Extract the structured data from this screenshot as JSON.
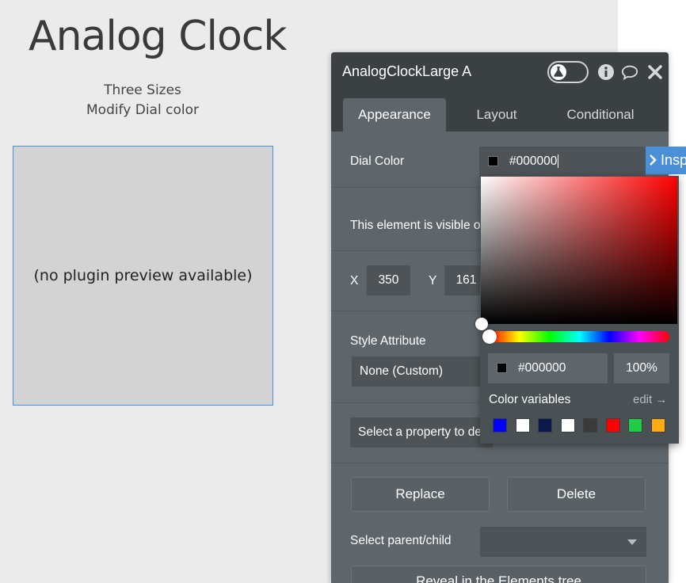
{
  "canvas": {
    "title": "Analog Clock",
    "subtitle_line1": "Three Sizes",
    "subtitle_line2": "Modify Dial color",
    "preview_text": "(no plugin preview available)"
  },
  "panel": {
    "title": "AnalogClockLarge A",
    "tabs": [
      {
        "label": "Appearance",
        "active": true
      },
      {
        "label": "Layout",
        "active": false
      },
      {
        "label": "Conditional",
        "active": false
      }
    ],
    "dial_color_label": "Dial Color",
    "dial_color_value": "#000000",
    "inspect_label": "Insp",
    "visible_text": "This element is visible o",
    "x_label": "X",
    "x_value": "350",
    "y_label": "Y",
    "y_value": "161",
    "style_attribute_label": "Style Attribute",
    "style_attribute_value": "None (Custom)",
    "select_property_text": "Select a property to de",
    "replace_label": "Replace",
    "delete_label": "Delete",
    "parent_child_label": "Select parent/child",
    "parent_child_value": "",
    "reveal_label": "Reveal in the Elements tree"
  },
  "picker": {
    "hex": "#000000",
    "alpha": "100%",
    "vars_label": "Color variables",
    "edit_label": "edit →",
    "variables": [
      "#0000ff",
      "#ffffff",
      "#0b1a4a",
      "#ffffff",
      "#3a3a3a",
      "#ff0000",
      "#22cc44",
      "#ffaa11"
    ]
  },
  "icons": {
    "toggle": "flask-icon",
    "info": "info-icon",
    "comment": "comment-icon",
    "close": "close-icon",
    "inspect": "chevron-right-icon"
  }
}
